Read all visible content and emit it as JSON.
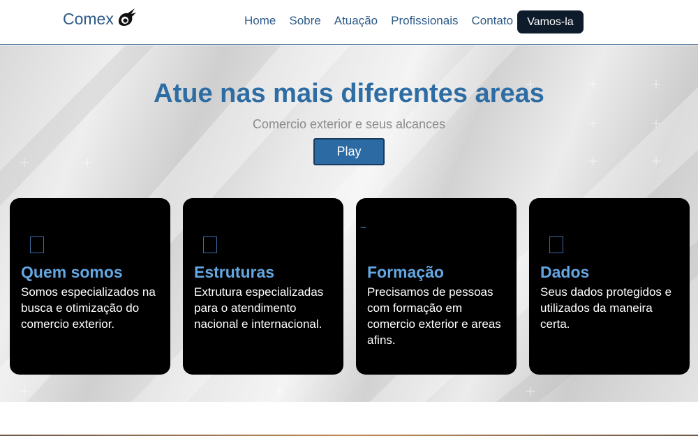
{
  "navbar": {
    "brand": "Comex",
    "links": [
      "Home",
      "Sobre",
      "Atuação",
      "Profissionais",
      "Contato"
    ],
    "cta_label": "Vamos-la"
  },
  "hero": {
    "title": "Atue nas mais diferentes areas",
    "subtitle": "Comercio exterior e seus alcances",
    "button_label": "Play"
  },
  "cards": [
    {
      "icon": "square-icon",
      "title": "Quem somos",
      "text": "Somos especializados na busca e otimização do comercio exterior."
    },
    {
      "icon": "square-icon",
      "title": "Estruturas",
      "text": "Extrutura especializadas para o atendimento nacional e internacional."
    },
    {
      "icon": "tilde-icon",
      "title": "Formação",
      "text": "Precisamos de pessoas com formação em comercio exterior e areas afins."
    },
    {
      "icon": "square-icon",
      "title": "Dados",
      "text": "Seus dados protegidos e utilizados da maneira certa."
    }
  ],
  "colors": {
    "primary": "#2c5a87",
    "accent": "#64a7e2",
    "cta_background": "#0d1b2a",
    "card_background": "#000000"
  }
}
